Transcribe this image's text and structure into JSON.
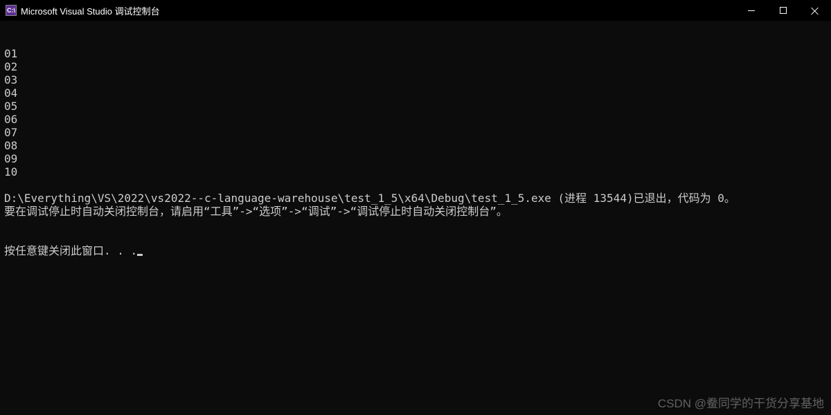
{
  "titlebar": {
    "icon_text": "C:\\",
    "title": "Microsoft Visual Studio 调试控制台"
  },
  "console": {
    "lines": [
      "01",
      "02",
      "03",
      "04",
      "05",
      "06",
      "07",
      "08",
      "09",
      "10",
      "",
      "D:\\Everything\\VS\\2022\\vs2022--c-language-warehouse\\test_1_5\\x64\\Debug\\test_1_5.exe (进程 13544)已退出，代码为 0。",
      "要在调试停止时自动关闭控制台，请启用“工具”->“选项”->“调试”->“调试停止时自动关闭控制台”。"
    ],
    "prompt_line": "按任意键关闭此窗口. . ."
  },
  "watermark": "CSDN @鲞同学的干货分享基地"
}
